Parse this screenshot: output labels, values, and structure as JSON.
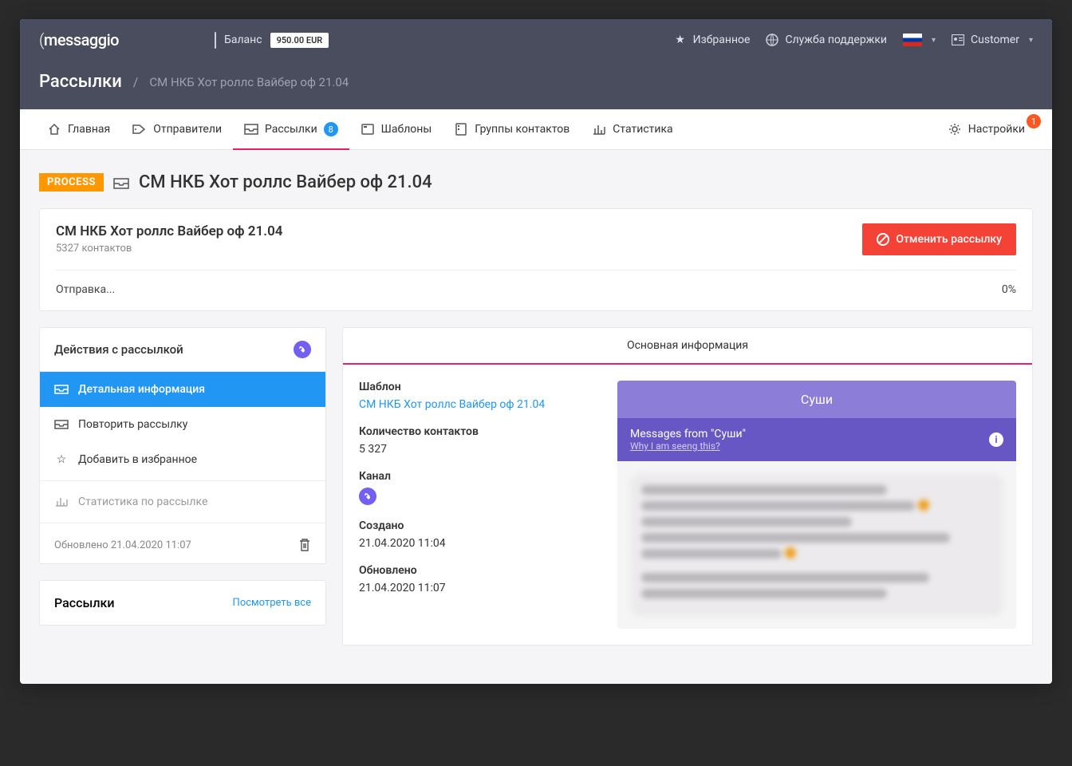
{
  "brand": "messaggio",
  "topbar": {
    "balance_label": "Баланс",
    "balance_value": "950.00 EUR",
    "favorites": "Избранное",
    "support": "Служба поддержки",
    "customer": "Customer"
  },
  "breadcrumb": {
    "section": "Рассылки",
    "page": "СМ НКБ Хот роллс Вайбер оф 21.04"
  },
  "nav": {
    "home": "Главная",
    "senders": "Отправители",
    "campaigns": "Рассылки",
    "campaigns_count": "8",
    "templates": "Шаблоны",
    "contacts": "Группы контактов",
    "stats": "Статистика",
    "settings": "Настройки",
    "settings_badge": "1"
  },
  "page": {
    "status": "PROCESS",
    "title": "СМ НКБ Хот роллс Вайбер оф 21.04"
  },
  "summary": {
    "title": "СМ НКБ Хот роллс Вайбер оф 21.04",
    "contacts": "5327 контактов",
    "cancel_btn": "Отменить рассылку",
    "sending": "Отправка...",
    "percent": "0%"
  },
  "actions": {
    "title": "Действия с рассылкой",
    "detail": "Детальная информация",
    "repeat": "Повторить рассылку",
    "fav": "Добавить в избранное",
    "stats": "Статистика по рассылке",
    "updated": "Обновлено 21.04.2020 11:07"
  },
  "secondary": {
    "title": "Рассылки",
    "view_all": "Посмотреть все"
  },
  "info": {
    "tab": "Основная информация",
    "template_label": "Шаблон",
    "template_val": "СМ НКБ Хот роллс Вайбер оф 21.04",
    "count_label": "Количество контактов",
    "count_val": "5 327",
    "channel_label": "Канал",
    "created_label": "Создано",
    "created_val": "21.04.2020 11:04",
    "updated_label": "Обновлено",
    "updated_val": "21.04.2020 11:07"
  },
  "preview": {
    "title": "Суши",
    "messages_from": "Messages from \"Суши\"",
    "why": "Why I am seeng this?"
  }
}
